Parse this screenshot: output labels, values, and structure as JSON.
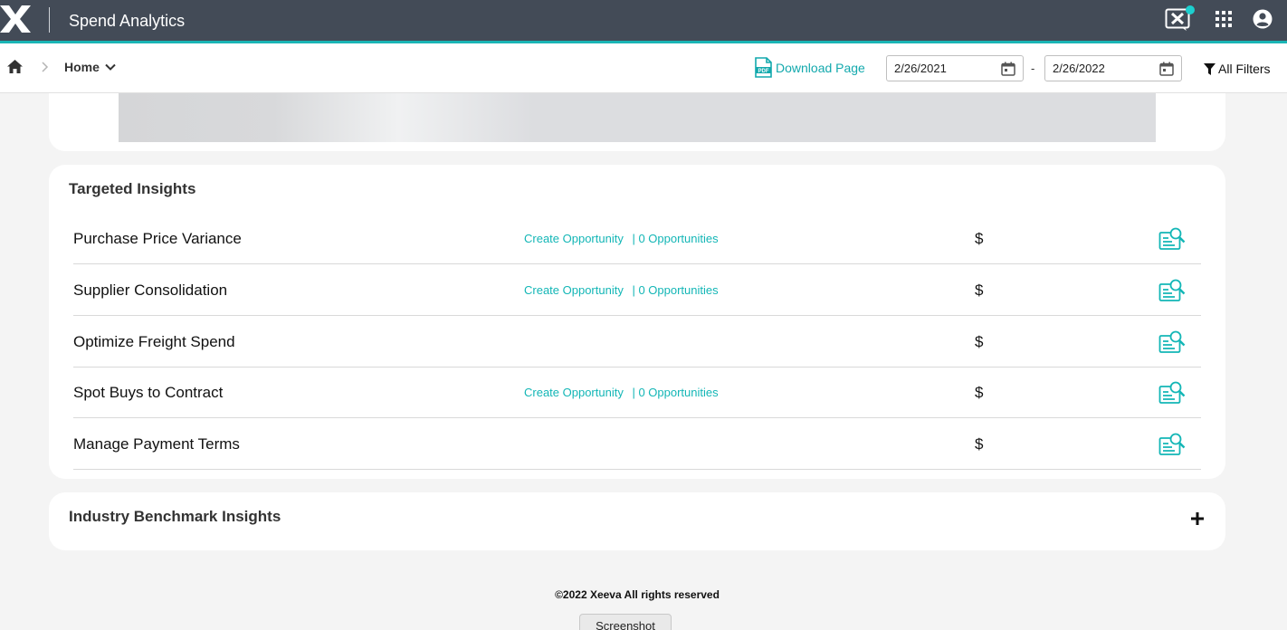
{
  "header": {
    "app_title": "Spend Analytics",
    "logo_icon": "x-logo-icon",
    "accent_color": "#1ab5b5"
  },
  "subheader": {
    "breadcrumb_home_label": "Home",
    "download_label": "Download Page",
    "pdf_icon_label": "PDF",
    "date_from": "2/26/2021",
    "date_separator": "-",
    "date_to": "2/26/2022",
    "filters_label": "All Filters"
  },
  "targeted_insights": {
    "title": "Targeted Insights",
    "rows": [
      {
        "name": "Purchase Price Variance",
        "create_label": "Create Opportunity",
        "count_label": "| 0 Opportunities",
        "value": "$"
      },
      {
        "name": "Supplier Consolidation",
        "create_label": "Create Opportunity",
        "count_label": "| 0 Opportunities",
        "value": "$"
      },
      {
        "name": "Optimize Freight Spend",
        "create_label": "",
        "count_label": "",
        "value": "$"
      },
      {
        "name": "Spot Buys to Contract",
        "create_label": "Create Opportunity",
        "count_label": "| 0 Opportunities",
        "value": "$"
      },
      {
        "name": "Manage Payment Terms",
        "create_label": "",
        "count_label": "",
        "value": "$"
      }
    ]
  },
  "benchmark": {
    "title": "Industry Benchmark Insights"
  },
  "footer": {
    "copyright": "©2022 Xeeva All rights reserved",
    "screenshot_label": "Screenshot"
  }
}
